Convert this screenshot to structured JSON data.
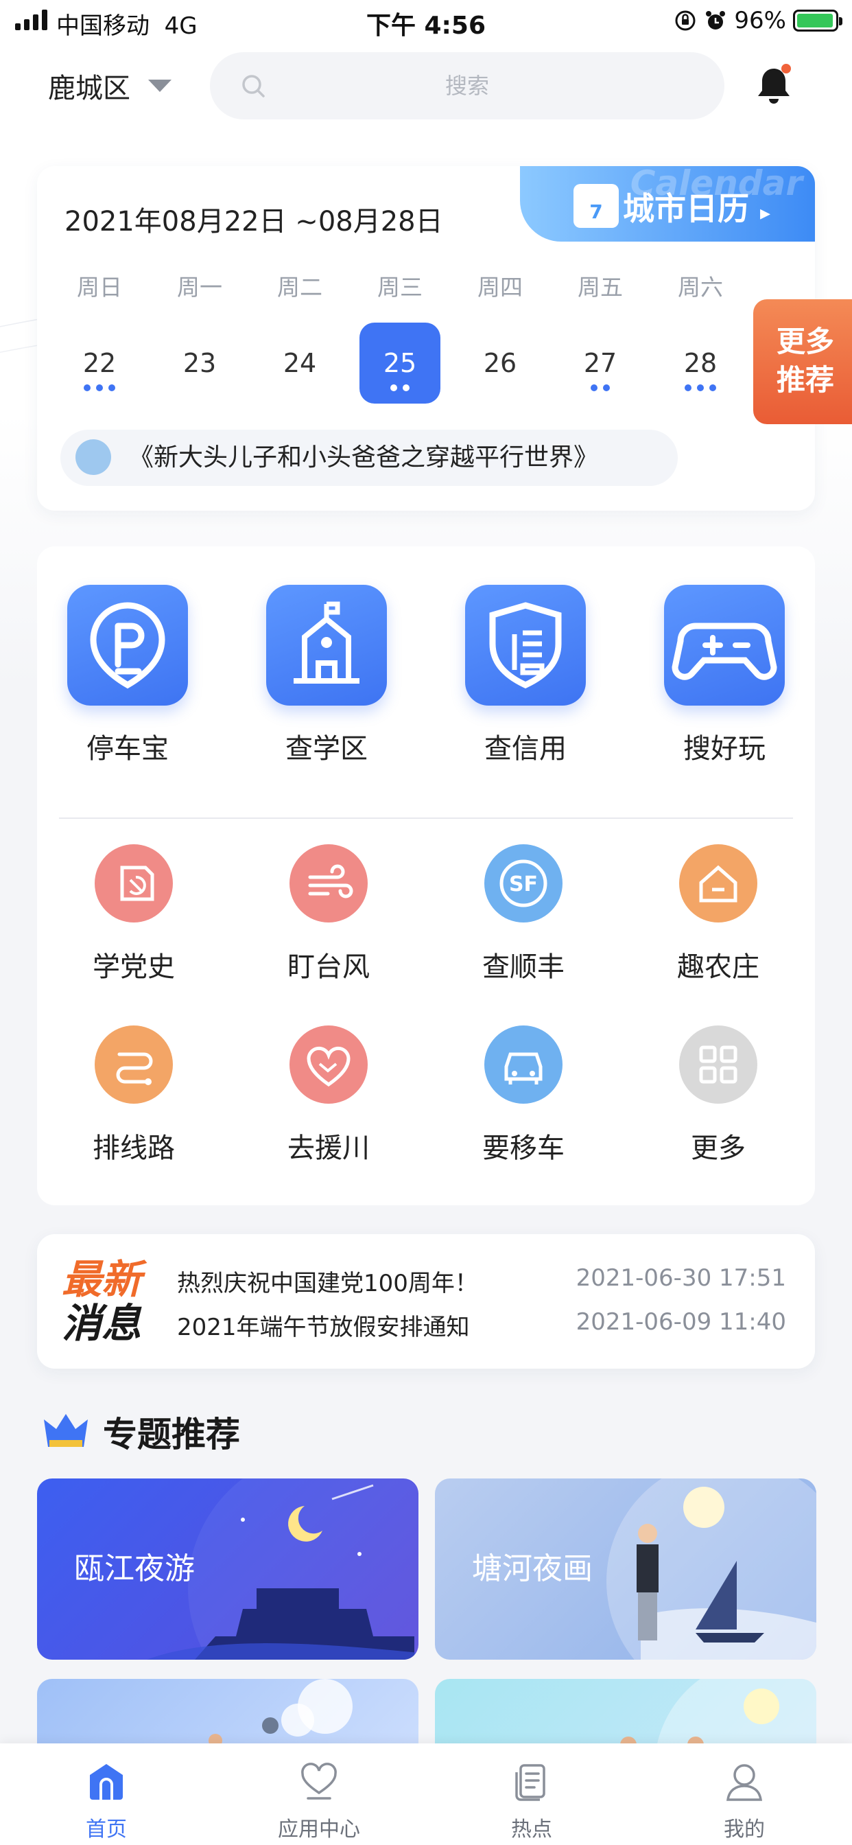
{
  "status_bar": {
    "carrier": "中国移动",
    "network": "4G",
    "time": "下午 4:56",
    "battery": "96%",
    "battery_level": 0.96
  },
  "header": {
    "city": "鹿城区",
    "search_placeholder": "搜索"
  },
  "calendar": {
    "range": "2021年08月22日 ~08月28日",
    "badge_label": "城市日历",
    "badge_ghost_text": "Calendar",
    "badge_icon_day": "7",
    "weekdays": [
      "周日",
      "周一",
      "周二",
      "周三",
      "周四",
      "周五",
      "周六"
    ],
    "days": [
      {
        "num": "22",
        "dots": 3,
        "selected": false
      },
      {
        "num": "23",
        "dots": 0,
        "selected": false
      },
      {
        "num": "24",
        "dots": 0,
        "selected": false
      },
      {
        "num": "25",
        "dots": 2,
        "selected": true
      },
      {
        "num": "26",
        "dots": 0,
        "selected": false
      },
      {
        "num": "27",
        "dots": 2,
        "selected": false
      },
      {
        "num": "28",
        "dots": 3,
        "selected": false
      }
    ],
    "event": "《新大头儿子和小头爸爸之穿越平行世界》"
  },
  "more_recommend": "更多推荐",
  "primary_apps": [
    {
      "label": "停车宝",
      "icon": "parking-icon"
    },
    {
      "label": "查学区",
      "icon": "school-district-icon"
    },
    {
      "label": "查信用",
      "icon": "credit-shield-icon"
    },
    {
      "label": "搜好玩",
      "icon": "gamepad-icon"
    }
  ],
  "secondary_apps": [
    {
      "label": "学党史",
      "icon": "party-history-icon",
      "color": "#f08b87"
    },
    {
      "label": "盯台风",
      "icon": "typhoon-wind-icon",
      "color": "#f08b87"
    },
    {
      "label": "查顺丰",
      "icon": "sf-express-icon",
      "color": "#6fb1f0"
    },
    {
      "label": "趣农庄",
      "icon": "farm-house-icon",
      "color": "#f3a566"
    },
    {
      "label": "排线路",
      "icon": "route-icon",
      "color": "#f3a566"
    },
    {
      "label": "去援川",
      "icon": "heart-hands-icon",
      "color": "#f08b87"
    },
    {
      "label": "要移车",
      "icon": "car-icon",
      "color": "#6fb1f0"
    },
    {
      "label": "更多",
      "icon": "grid-more-icon",
      "color": "#d9d9d9"
    }
  ],
  "news": {
    "logo_line1": "最新",
    "logo_line2": "消息",
    "items": [
      {
        "title": "热烈庆祝中国建党100周年！",
        "time": "2021-06-30 17:51"
      },
      {
        "title": "2021年端午节放假安排通知",
        "time": "2021-06-09 11:40"
      }
    ]
  },
  "topics": {
    "title": "专题推荐",
    "cards": [
      {
        "label": "瓯江夜游"
      },
      {
        "label": "塘河夜画"
      },
      {
        "label": ""
      },
      {
        "label": ""
      }
    ]
  },
  "tabbar": [
    {
      "label": "首页",
      "icon": "home-icon",
      "active": true
    },
    {
      "label": "应用中心",
      "icon": "app-center-heart-icon",
      "active": false
    },
    {
      "label": "热点",
      "icon": "hot-news-icon",
      "active": false
    },
    {
      "label": "我的",
      "icon": "profile-icon",
      "active": false
    }
  ],
  "colors": {
    "accent": "#3f74f4",
    "news_orange": "#f06b2a",
    "more_tab": "#e95c35"
  }
}
